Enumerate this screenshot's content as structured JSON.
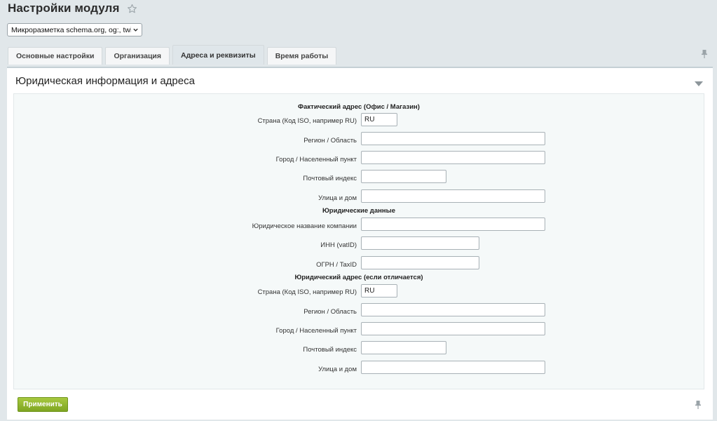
{
  "header": {
    "title": "Настройки модуля"
  },
  "selector": {
    "value": "Микроразметка schema.org, og:, twitter:"
  },
  "tabs": [
    {
      "label": "Основные настройки"
    },
    {
      "label": "Организация"
    },
    {
      "label": "Адреса и реквизиты",
      "active": true
    },
    {
      "label": "Время работы"
    }
  ],
  "panel": {
    "title": "Юридическая информация и адреса"
  },
  "actual_address": {
    "title": "Фактический адрес (Офис / Магазин)",
    "country_label": "Страна (Код ISO, например RU)",
    "country_value": "RU",
    "region_label": "Регион / Область",
    "region_value": "",
    "city_label": "Город / Населенный пункт",
    "city_value": "",
    "zip_label": "Почтовый индекс",
    "zip_value": "",
    "street_label": "Улица и дом",
    "street_value": ""
  },
  "legal_data": {
    "title": "Юридические данные",
    "company_label": "Юридическое название компании",
    "company_value": "",
    "inn_label": "ИНН (vatID)",
    "inn_value": "",
    "ogrn_label": "ОГРН / TaxID",
    "ogrn_value": ""
  },
  "legal_address": {
    "title": "Юридический адрес (если отличается)",
    "country_label": "Страна (Код ISO, например RU)",
    "country_value": "RU",
    "region_label": "Регион / Область",
    "region_value": "",
    "city_label": "Город / Населенный пункт",
    "city_value": "",
    "zip_label": "Почтовый индекс",
    "zip_value": "",
    "street_label": "Улица и дом",
    "street_value": ""
  },
  "footer": {
    "apply_label": "Применить"
  },
  "colors": {
    "accent_button": "#8cb42c",
    "page_bg": "#e1e7ea",
    "form_bg": "#f5f9f9"
  },
  "icons": {
    "favorite": "star-icon",
    "dropdown": "chevron-down-icon",
    "pin": "pin-icon",
    "collapse": "triangle-down-icon"
  }
}
